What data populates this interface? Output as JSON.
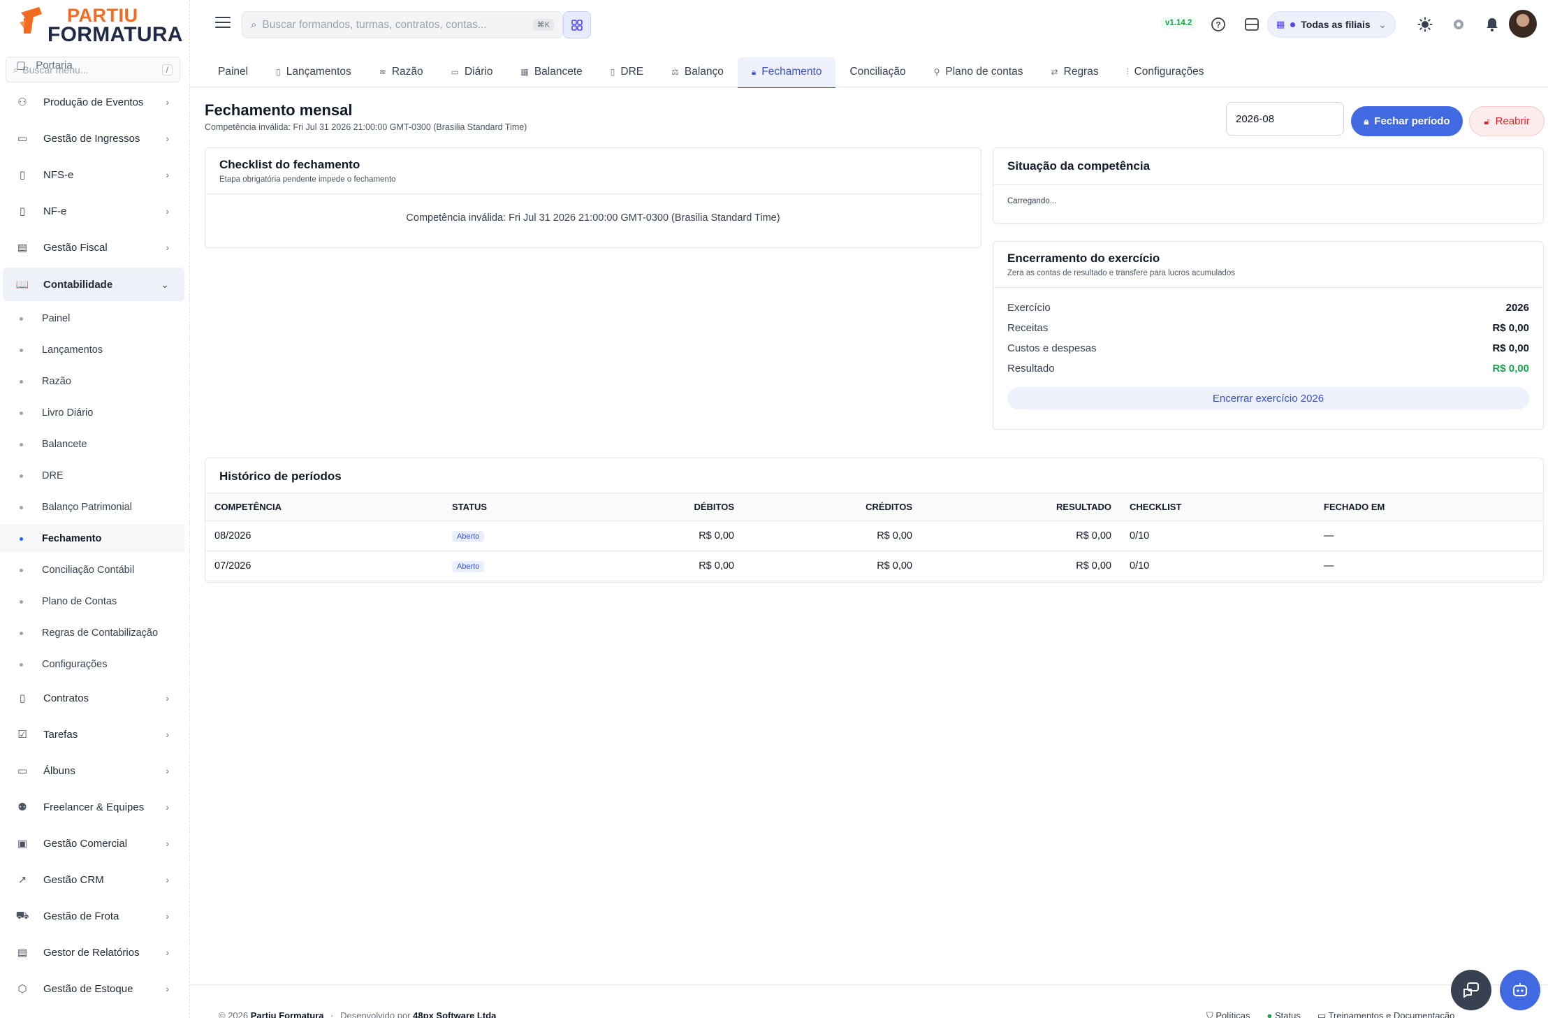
{
  "app": {
    "logo_line1": "PARTIU",
    "logo_line2": "FORMATURA",
    "version": "v1.14.2"
  },
  "sidebar": {
    "search_placeholder": "Buscar menu...",
    "search_kbd": "/",
    "ghost_item": "Portaria",
    "items": [
      {
        "label": "Produção de Eventos",
        "icon": "party-icon"
      },
      {
        "label": "Gestão de Ingressos",
        "icon": "ticket-icon"
      },
      {
        "label": "NFS-e",
        "icon": "document-icon"
      },
      {
        "label": "NF-e",
        "icon": "document-icon"
      },
      {
        "label": "Gestão Fiscal",
        "icon": "receipt-icon"
      },
      {
        "label": "Contabilidade",
        "icon": "book-icon"
      },
      {
        "label": "Contratos",
        "icon": "contract-icon"
      },
      {
        "label": "Tarefas",
        "icon": "checkbox-icon"
      },
      {
        "label": "Álbuns",
        "icon": "album-icon"
      },
      {
        "label": "Freelancer & Equipes",
        "icon": "team-icon"
      },
      {
        "label": "Gestão Comercial",
        "icon": "briefcase-icon"
      },
      {
        "label": "Gestão CRM",
        "icon": "chart-icon"
      },
      {
        "label": "Gestão de Frota",
        "icon": "truck-icon"
      },
      {
        "label": "Gestor de Relatórios",
        "icon": "report-icon"
      },
      {
        "label": "Gestão de Estoque",
        "icon": "box-icon"
      }
    ],
    "sub_items": [
      "Painel",
      "Lançamentos",
      "Razão",
      "Livro Diário",
      "Balancete",
      "DRE",
      "Balanço Patrimonial",
      "Fechamento",
      "Conciliação Contábil",
      "Plano de Contas",
      "Regras de Contabilização",
      "Configurações"
    ]
  },
  "topbar": {
    "search_placeholder": "Buscar formandos, turmas, contratos, contas...",
    "search_kbd": "⌘K",
    "branch_label": "Todas as filiais"
  },
  "tabs": [
    "Painel",
    "Lançamentos",
    "Razão",
    "Diário",
    "Balancete",
    "DRE",
    "Balanço",
    "Fechamento",
    "Conciliação",
    "Plano de contas",
    "Regras",
    "Configurações"
  ],
  "page": {
    "title": "Fechamento mensal",
    "subtitle": "Competência inválida: Fri Jul 31 2026 21:00:00 GMT-0300 (Brasilia Standard Time)",
    "period_value": "2026-08",
    "close_button": "Fechar período",
    "reopen_button": "Reabrir"
  },
  "checklist": {
    "title": "Checklist do fechamento",
    "subtitle": "Etapa obrigatória pendente impede o fechamento",
    "message": "Competência inválida: Fri Jul 31 2026 21:00:00 GMT-0300 (Brasilia Standard Time)"
  },
  "situacao": {
    "title": "Situação da competência",
    "loading": "Carregando..."
  },
  "encerramento": {
    "title": "Encerramento do exercício",
    "subtitle": "Zera as contas de resultado e transfere para lucros acumulados",
    "rows": [
      {
        "label": "Exercício",
        "value": "2026"
      },
      {
        "label": "Receitas",
        "value": "R$ 0,00"
      },
      {
        "label": "Custos e despesas",
        "value": "R$ 0,00"
      },
      {
        "label": "Resultado",
        "value": "R$ 0,00"
      }
    ],
    "button": "Encerrar exercício 2026"
  },
  "historico": {
    "title": "Histórico de períodos",
    "columns": [
      "COMPETÊNCIA",
      "STATUS",
      "DÉBITOS",
      "CRÉDITOS",
      "RESULTADO",
      "CHECKLIST",
      "FECHADO EM"
    ],
    "rows": [
      {
        "competencia": "08/2026",
        "status": "Aberto",
        "debitos": "R$ 0,00",
        "creditos": "R$ 0,00",
        "resultado": "R$ 0,00",
        "checklist": "0/10",
        "fechado_em": "—"
      },
      {
        "competencia": "07/2026",
        "status": "Aberto",
        "debitos": "R$ 0,00",
        "creditos": "R$ 0,00",
        "resultado": "R$ 0,00",
        "checklist": "0/10",
        "fechado_em": "—"
      }
    ]
  },
  "footer": {
    "copyright": "© 2026",
    "company": "Partiu Formatura",
    "sep": "·",
    "dev_by": "Desenvolvido por",
    "dev_company": "48px Software Ltda",
    "links": [
      "Políticas",
      "Status",
      "Treinamentos e Documentação"
    ]
  },
  "colors": {
    "accent": "#4169e1",
    "danger": "#dc2626",
    "success": "#16a34a",
    "brand_orange": "#f26b21",
    "brand_navy": "#1f2a44"
  }
}
